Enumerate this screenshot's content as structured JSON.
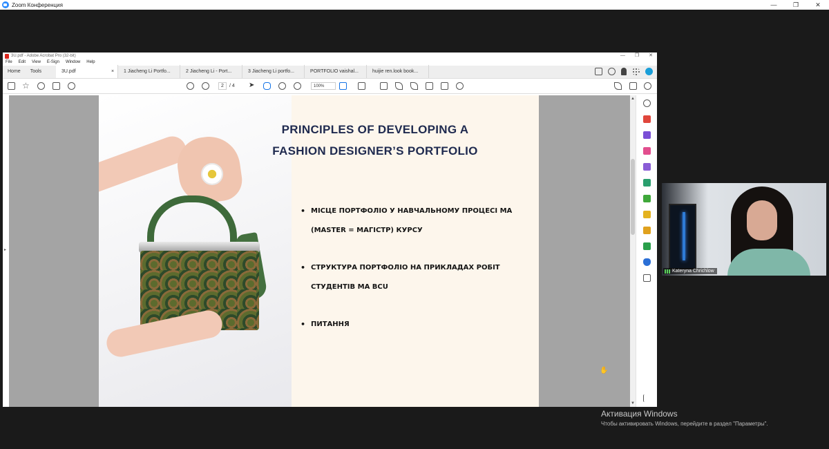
{
  "zoom": {
    "title": "Zoom Конференция",
    "controls": [
      "—",
      "❐",
      "✕"
    ]
  },
  "acrobat": {
    "title": "3U.pdf - Adobe Acrobat Pro (32-bit)",
    "window_controls": [
      "—",
      "❐",
      "✕"
    ],
    "menu": [
      "File",
      "Edit",
      "View",
      "E-Sign",
      "Window",
      "Help"
    ],
    "tabs": {
      "home": "Home",
      "tools": "Tools",
      "active": "3U.pdf",
      "close": "×",
      "docs": [
        "1 Jiacheng Li Portfo...",
        "2 Jiacheng Li - Port...",
        "3 Jiacheng Li portfo...",
        "PORTFOLIO vaishal...",
        "huijie ren.look book..."
      ]
    },
    "toolbar": {
      "page_current": "2",
      "page_total": "/ 4",
      "zoom_level": "100%"
    }
  },
  "slide": {
    "title_line1": "PRINCIPLES OF DEVELOPING A",
    "title_line2": "FASHION DESIGNER’S PORTFOLIO",
    "bullets": [
      "МІСЦЕ ПОРТФОЛІО У НАВЧАЛЬНОМУ ПРОЦЕСІ МА (MASTER = МАГІСТР) КУРСУ",
      "СТРУКТУРА ПОРТФОЛІО НА ПРИКЛАДАХ РОБІТ СТУДЕНТІВ МА BCU",
      "ПИТАННЯ"
    ],
    "colors": {
      "title": "#1f2a4f",
      "background": "#fdf6ec"
    }
  },
  "webcam": {
    "participant_name": "Kateryna Chrichlow"
  },
  "windows_activation": {
    "line1": "Активация Windows",
    "line2": "Чтобы активировать Windows, перейдите в раздел \"Параметры\"."
  }
}
